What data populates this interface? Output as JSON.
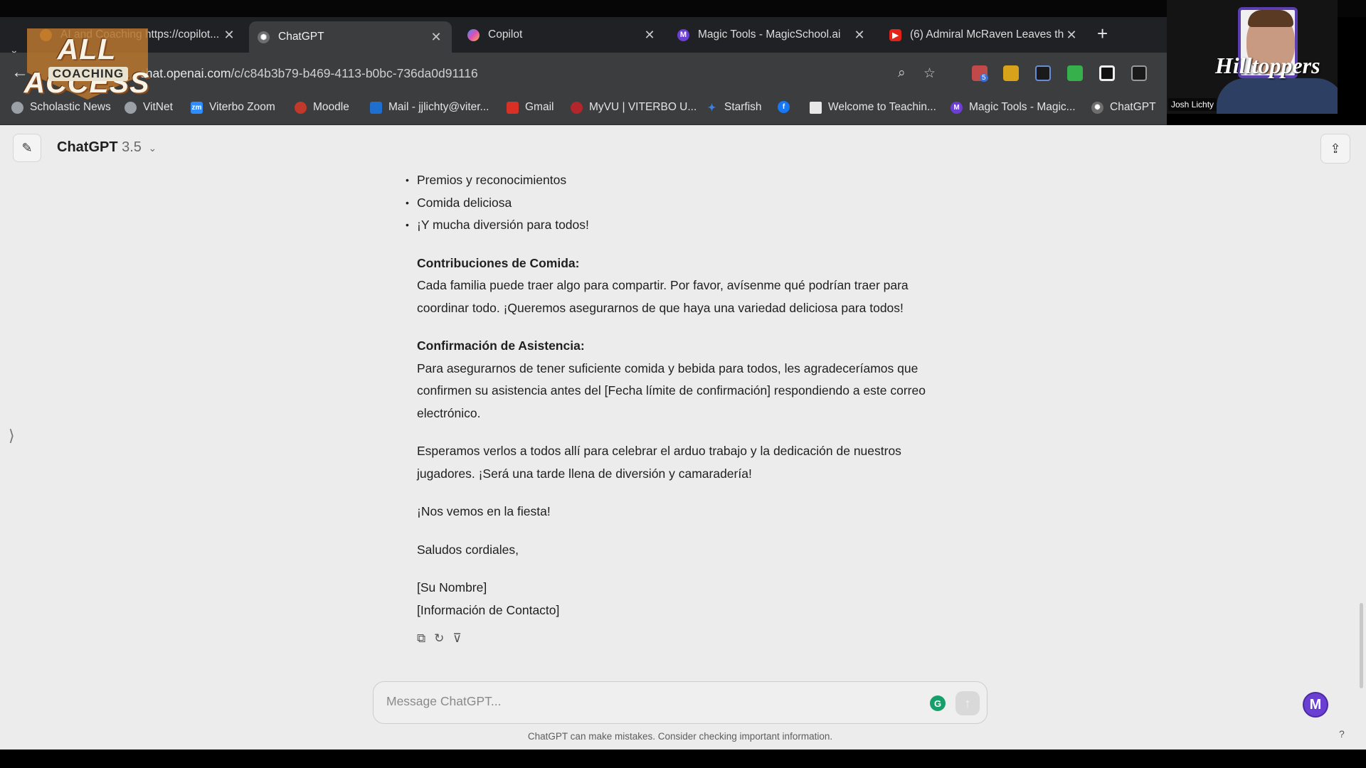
{
  "browser": {
    "tabs": [
      {
        "title": "AI and Coaching https://copilot...",
        "icon_color": "#e8a317"
      },
      {
        "title": "ChatGPT",
        "icon_color": "#6e6e6e"
      },
      {
        "title": "Copilot",
        "icon_color": "#3b8ef0"
      },
      {
        "title": "Magic Tools - MagicSchool.ai",
        "icon_color": "#6b3fd1"
      },
      {
        "title": "(6) Admiral McRaven Leaves th",
        "icon_color": "#e62117"
      }
    ],
    "url_host": "chat.openai.com",
    "url_path": "/c/c84b3b79-b469-4113-b0bc-736da0d91116",
    "bookmarks": [
      {
        "label": "Scholastic News"
      },
      {
        "label": "VitNet"
      },
      {
        "label": "Viterbo Zoom"
      },
      {
        "label": "Moodle"
      },
      {
        "label": "Mail - jjlichty@viter..."
      },
      {
        "label": "Gmail"
      },
      {
        "label": "MyVU | VITERBO U..."
      },
      {
        "label": "Starfish"
      },
      {
        "label": "Welcome to Teachin..."
      },
      {
        "label": "Magic Tools - Magic..."
      },
      {
        "label": "ChatGPT"
      }
    ],
    "extension_badge": "5"
  },
  "overlay": {
    "logo_top": "ALL ACCESS",
    "logo_sub": "COACHING",
    "cam_text": "Hilltoppers",
    "cam_name": "Josh Lichty"
  },
  "chat": {
    "model_name": "ChatGPT",
    "model_version": "3.5",
    "bullets": [
      "Premios y reconocimientos",
      "Comida deliciosa",
      "¡Y mucha diversión para todos!"
    ],
    "food_heading": "Contribuciones de Comida:",
    "food_text": "Cada familia puede traer algo para compartir. Por favor, avísenme qué podrían traer para coordinar todo. ¡Queremos asegurarnos de que haya una variedad deliciosa para todos!",
    "rsvp_heading": "Confirmación de Asistencia:",
    "rsvp_text": "Para asegurarnos de tener suficiente comida y bebida para todos, les agradeceríamos que confirmen su asistencia antes del [Fecha límite de confirmación] respondiendo a este correo electrónico.",
    "closing_text": "Esperamos verlos a todos allí para celebrar el arduo trabajo y la dedicación de nuestros jugadores. ¡Será una tarde llena de diversión y camaradería!",
    "see_you": "¡Nos vemos en la fiesta!",
    "regards": "Saludos cordiales,",
    "name_placeholder": "[Su Nombre]",
    "contact_placeholder": "[Información de Contacto]"
  },
  "composer": {
    "placeholder": "Message ChatGPT..."
  },
  "disclaimer": "ChatGPT can make mistakes. Consider checking important information.",
  "help": "?"
}
